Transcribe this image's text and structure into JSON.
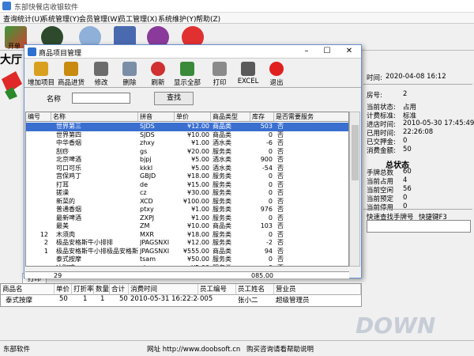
{
  "app": {
    "title": "东部快餐店收银软件",
    "menu": [
      "查询统计(U)",
      "系统管理(Y)",
      "会员管理(W)",
      "员工管理(X)",
      "系统维护(Y)",
      "帮助(Z)"
    ],
    "toolbar_first_label": "开单",
    "hall_label": "大厅"
  },
  "dialog": {
    "title": "商品项目管理",
    "window_buttons": [
      "–",
      "☐",
      "✕"
    ],
    "toolbar": [
      {
        "label": "增加项目",
        "icon": "add-item-icon",
        "color": "#d9a020"
      },
      {
        "label": "商品进货",
        "icon": "stock-in-icon",
        "color": "#c98a10"
      },
      {
        "label": "修改",
        "icon": "edit-tools-icon",
        "color": "#6b6b6b"
      },
      {
        "label": "删除",
        "icon": "delete-bin-icon",
        "color": "#7a8ea8"
      },
      {
        "label": "刷新",
        "icon": "refresh-icon",
        "color": "#d03030"
      },
      {
        "label": "显示全部",
        "icon": "show-all-icon",
        "color": "#3a8a3a"
      },
      {
        "label": "打印",
        "icon": "printer-icon",
        "color": "#8a8a8a"
      },
      {
        "label": "EXCEL",
        "icon": "excel-icon",
        "color": "#5a5a5a"
      },
      {
        "label": "退出",
        "icon": "exit-icon",
        "color": "#e02020"
      }
    ],
    "search": {
      "name_label": "名称",
      "name_value": "",
      "button": "查找"
    },
    "columns": [
      "编号",
      "名称",
      "拼音",
      "单价",
      "商品类型",
      "库存",
      "是否需要服务"
    ],
    "rows": [
      [
        "",
        "世界第三",
        "SJDS",
        "¥12.00",
        "商品类",
        "503",
        "否"
      ],
      [
        "",
        "世界第四",
        "SJDS",
        "¥10.00",
        "商品类",
        "0",
        "否"
      ],
      [
        "",
        "中华香烟",
        "zhxy",
        "¥1.00",
        "酒水类",
        "-6",
        "否"
      ],
      [
        "",
        "刮痧",
        "gs",
        "¥20.00",
        "服务类",
        "0",
        "否"
      ],
      [
        "",
        "北京啤酒",
        "bjpj",
        "¥5.00",
        "酒水类",
        "900",
        "否"
      ],
      [
        "",
        "可口可乐",
        "kkkl",
        "¥5.00",
        "酒水类",
        "-54",
        "否"
      ],
      [
        "",
        "宫保鸡丁",
        "GBJD",
        "¥18.00",
        "服务类",
        "0",
        "否"
      ],
      [
        "",
        "打耳",
        "de",
        "¥15.00",
        "服务类",
        "0",
        "否"
      ],
      [
        "",
        "搓澡",
        "cz",
        "¥30.00",
        "服务类",
        "0",
        "否"
      ],
      [
        "",
        "新菜的",
        "XCD",
        "¥100.00",
        "服务类",
        "0",
        "否"
      ],
      [
        "",
        "普通香烟",
        "ptxy",
        "¥1.00",
        "服务类",
        "976",
        "否"
      ],
      [
        "",
        "最新啤酒",
        "ZXPJ",
        "¥1.00",
        "服务类",
        "0",
        "否"
      ],
      [
        "",
        "最美",
        "ZM",
        "¥10.00",
        "商品类",
        "103",
        "否"
      ],
      [
        "12",
        "木须肉",
        "MXR",
        "¥18.00",
        "服务类",
        "0",
        "否"
      ],
      [
        "2",
        "极品安格斯牛小排排",
        "JPAGSNXI",
        "¥12.00",
        "服务类",
        "-2",
        "否"
      ],
      [
        "1",
        "极品安格斯牛小排极品安格斯",
        "JPAGSNXI",
        "¥555.00",
        "商品类",
        "94",
        "否"
      ],
      [
        "",
        "泰式按摩",
        "tsam",
        "¥50.00",
        "服务类",
        "0",
        "否"
      ],
      [
        "",
        "冰咖啡",
        "xjc",
        "¥5.00",
        "服务类",
        "0",
        "否"
      ]
    ],
    "footer": {
      "count": "29",
      "total": "085.00"
    }
  },
  "right_panel": {
    "time_label": "时间:",
    "time_value": "2020-04-08 16:12",
    "room_label": "房号:",
    "room_value": "2",
    "info": [
      {
        "k": "当前状态:",
        "v": "占用"
      },
      {
        "k": "计费标准:",
        "v": "标准"
      },
      {
        "k": "进店时间:",
        "v": "2010-05-30 17:45:49"
      },
      {
        "k": "已用时间:",
        "v": "22:26:08"
      },
      {
        "k": "已交押金:",
        "v": "0"
      },
      {
        "k": "消费金额:",
        "v": "50"
      }
    ],
    "summary_title": "总状态",
    "summary": [
      {
        "k": "手牌总数",
        "v": "60"
      },
      {
        "k": "当前占用",
        "v": "4"
      },
      {
        "k": "当前空闲",
        "v": "56"
      },
      {
        "k": "当前预定",
        "v": "0"
      },
      {
        "k": "当前停用",
        "v": "0"
      }
    ],
    "quick_search": "快速查找手牌号",
    "hotkey": "快捷键F3"
  },
  "bottom": {
    "tabs": [
      "打印",
      "Excel"
    ],
    "columns": [
      "商品名",
      "单价",
      "打折率",
      "数量",
      "合计",
      "消费时间",
      "员工编号",
      "员工姓名",
      "营业员"
    ],
    "row": [
      "泰式按摩",
      "50",
      "1",
      "1",
      "50",
      "2010-05-31 16:22:24",
      "005",
      "张小二",
      "超级管理员"
    ]
  },
  "status": {
    "left": "东部软件",
    "site": "网址 http://www.doobsoft.cn",
    "buy": "购买咨询请看帮助说明"
  },
  "watermark": "DOWN",
  "colors": {
    "selection": "#3a6fd0",
    "accent": "#2e6fcf"
  }
}
